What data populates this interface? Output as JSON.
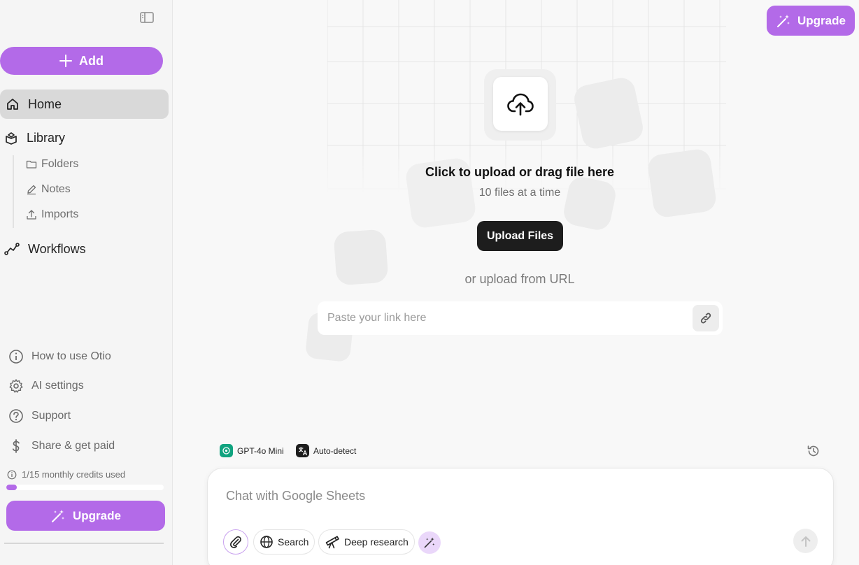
{
  "sidebar": {
    "add_label": "Add",
    "nav": {
      "home": "Home",
      "library": "Library",
      "folders": "Folders",
      "notes": "Notes",
      "imports": "Imports",
      "workflows": "Workflows"
    },
    "bottom": {
      "how_to": "How to use Otio",
      "ai_settings": "AI settings",
      "support": "Support",
      "share": "Share & get paid"
    },
    "credits_text": "1/15 monthly credits used",
    "credits_used": 1,
    "credits_total": 15,
    "upgrade_label": "Upgrade"
  },
  "header": {
    "upgrade_label": "Upgrade"
  },
  "upload": {
    "title": "Click to upload or drag file here",
    "subtitle": "10 files at a time",
    "button_label": "Upload Files",
    "or_url": "or upload from URL",
    "url_placeholder": "Paste your link here"
  },
  "chat": {
    "model_label": "GPT-4o Mini",
    "language_label": "Auto-detect",
    "placeholder": "Chat with Google Sheets",
    "search_label": "Search",
    "deep_research_label": "Deep research"
  },
  "colors": {
    "accent": "#b36ae8",
    "model_green": "#10a37f",
    "dark": "#1d1d1d"
  }
}
